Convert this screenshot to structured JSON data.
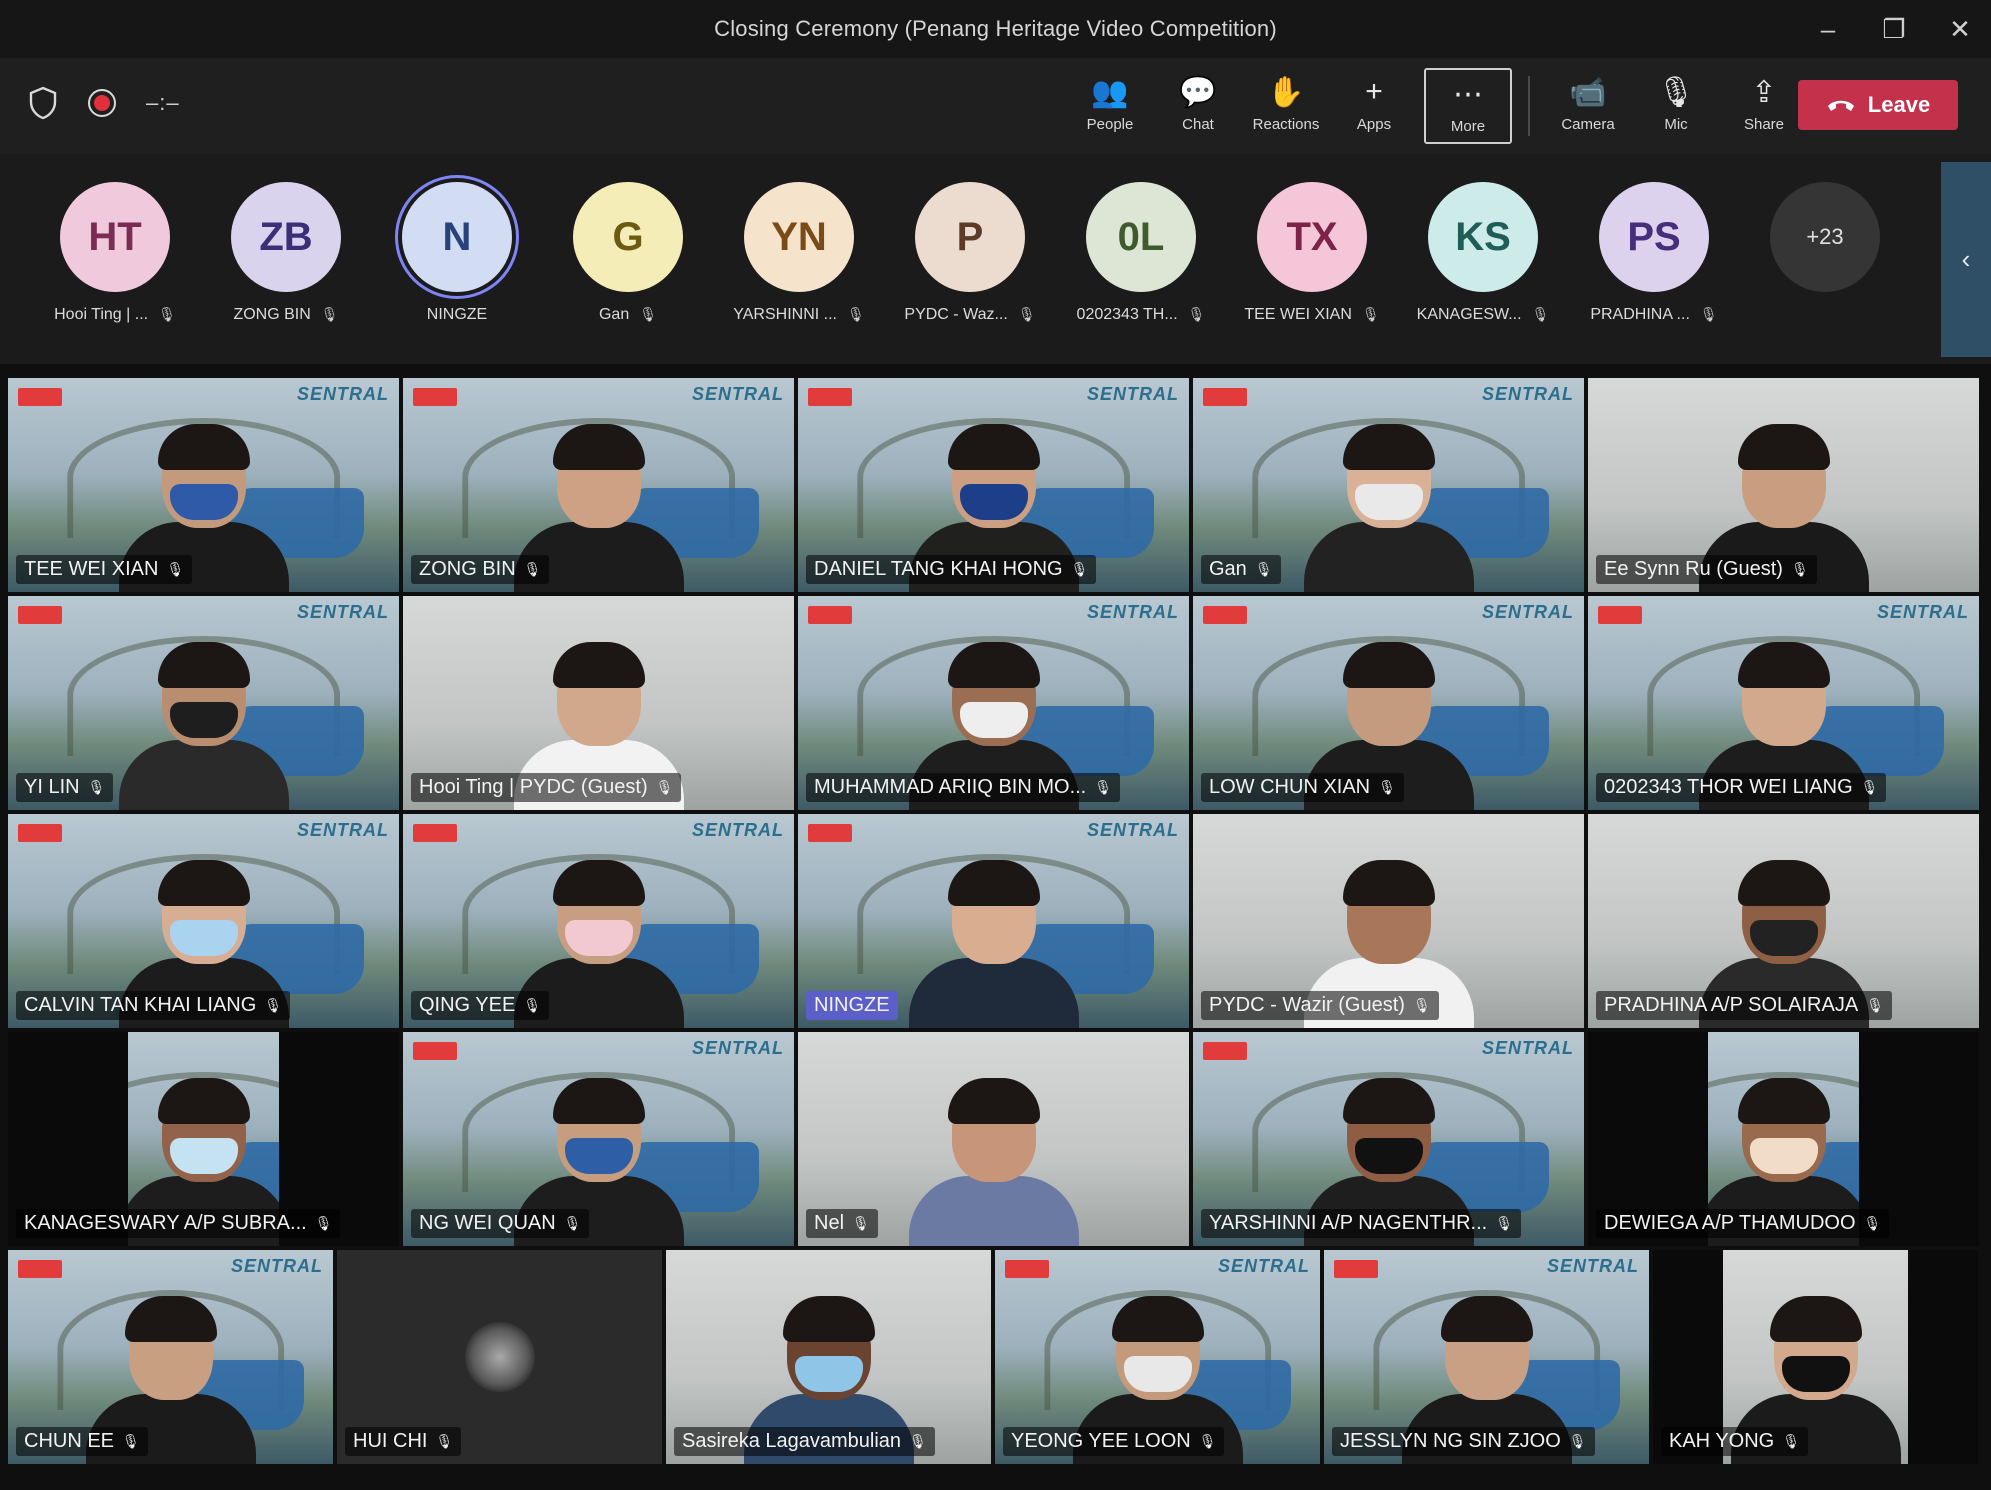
{
  "window": {
    "title": "Closing Ceremony (Penang Heritage Video Competition)",
    "controls": [
      "–",
      "❐",
      "✕"
    ]
  },
  "toolbar": {
    "timer": "–:–",
    "tools": [
      {
        "label": "People",
        "icon": "people-icon",
        "glyph": "👥"
      },
      {
        "label": "Chat",
        "icon": "chat-icon",
        "glyph": "💬"
      },
      {
        "label": "Reactions",
        "icon": "reactions-icon",
        "glyph": "✋"
      },
      {
        "label": "Apps",
        "icon": "apps-icon",
        "glyph": "+"
      },
      {
        "label": "More",
        "icon": "more-icon",
        "glyph": "⋯"
      }
    ],
    "media": [
      {
        "label": "Camera",
        "icon": "camera-icon",
        "glyph": "📹"
      },
      {
        "label": "Mic",
        "icon": "mic-off-icon",
        "glyph": "🎙"
      },
      {
        "label": "Share",
        "icon": "share-icon",
        "glyph": "⇪"
      }
    ],
    "leave_label": "Leave",
    "leave_color": "#c4314b"
  },
  "participants_strip": {
    "people": [
      {
        "initials": "HT",
        "name": "Hooi Ting | ...",
        "bg": "#f0c9dc",
        "fg": "#7a2c53"
      },
      {
        "initials": "ZB",
        "name": "ZONG BIN",
        "bg": "#d9d3ee",
        "fg": "#3c2f78"
      },
      {
        "initials": "N",
        "name": "NINGZE",
        "bg": "#d2dcf2",
        "fg": "#27437a"
      },
      {
        "initials": "G",
        "name": "Gan",
        "bg": "#f4edb8",
        "fg": "#6b5a12"
      },
      {
        "initials": "YN",
        "name": "YARSHINNI ...",
        "bg": "#f6e3cc",
        "fg": "#7a4b18"
      },
      {
        "initials": "P",
        "name": "PYDC - Waz...",
        "bg": "#ecdcd0",
        "fg": "#5b3b28"
      },
      {
        "initials": "0L",
        "name": "0202343 TH...",
        "bg": "#dde6d4",
        "fg": "#3f5a2b"
      },
      {
        "initials": "TX",
        "name": "TEE WEI XIAN",
        "bg": "#f4c6d7",
        "fg": "#7d2347"
      },
      {
        "initials": "KS",
        "name": "KANAGESW...",
        "bg": "#cdebe8",
        "fg": "#1f5e58"
      },
      {
        "initials": "PS",
        "name": "PRADHINA ...",
        "bg": "#dcd2ee",
        "fg": "#44307a"
      }
    ],
    "overflow": "+23"
  },
  "grid": {
    "rows": [
      [
        {
          "name": "TEE WEI XIAN",
          "bg": "sentral",
          "skin": "#c49a7c",
          "mask": "#2f5aa8",
          "shirt": "#1b1b1b"
        },
        {
          "name": "ZONG BIN",
          "bg": "sentral",
          "skin": "#cfa184",
          "mask": "",
          "shirt": "#1c1c1c"
        },
        {
          "name": "DANIEL TANG KHAI HONG",
          "bg": "sentral",
          "skin": "#cc9f83",
          "mask": "#1d3f8a",
          "shirt": "#20201f"
        },
        {
          "name": "Gan",
          "bg": "sentral",
          "skin": "#d8b196",
          "mask": "#e9e9ea",
          "shirt": "#222"
        },
        {
          "name": "Ee Synn Ru (Guest)",
          "bg": "room",
          "skin": "#c99d80",
          "mask": "",
          "shirt": "#1a1a1a"
        }
      ],
      [
        {
          "name": "YI LIN",
          "bg": "sentral",
          "skin": "#b98e70",
          "mask": "#1e1e1e",
          "shirt": "#2a2a2a"
        },
        {
          "name": "Hooi Ting | PYDC (Guest)",
          "bg": "room",
          "skin": "#d1a88c",
          "mask": "",
          "shirt": "#f2f2f2"
        },
        {
          "name": "MUHAMMAD ARIIQ BIN MO...",
          "bg": "sentral",
          "skin": "#9b6d52",
          "mask": "#eeeeee",
          "shirt": "#1e1e1e"
        },
        {
          "name": "LOW CHUN XIAN",
          "bg": "sentral",
          "skin": "#c49b7e",
          "mask": "",
          "shirt": "#1d1d1d"
        },
        {
          "name": "0202343 THOR WEI LIANG",
          "bg": "sentral",
          "skin": "#d2a98d",
          "mask": "",
          "shirt": "#1d1d1d"
        }
      ],
      [
        {
          "name": "CALVIN TAN KHAI LIANG",
          "bg": "sentral",
          "skin": "#d7ae93",
          "mask": "#a9d3ee",
          "shirt": "#1c1c1c"
        },
        {
          "name": "QING YEE",
          "bg": "sentral",
          "skin": "#c89e82",
          "mask": "#f2c8d1",
          "shirt": "#1c1c1c"
        },
        {
          "name": "NINGZE",
          "bg": "sentral",
          "skin": "#d9ad8f",
          "mask": "",
          "shirt": "#1f2a3a"
        },
        {
          "name": "PYDC - Wazir (Guest)",
          "bg": "room",
          "skin": "#a8775a",
          "mask": "",
          "shirt": "#f1f1f1"
        },
        {
          "name": "PRADHINA A/P SOLAIRAJA",
          "bg": "room",
          "skin": "#8e5f45",
          "mask": "#222",
          "shirt": "#2a2a2a"
        }
      ],
      [
        {
          "name": "KANAGESWARY A/P SUBRA...",
          "bg": "sentral",
          "skin": "#92634a",
          "mask": "#c5e2f2",
          "shirt": "#1d1d1d"
        },
        {
          "name": "NG WEI QUAN",
          "bg": "sentral",
          "skin": "#c79d80",
          "mask": "#2e5fa6",
          "shirt": "#1d1d1d"
        },
        {
          "name": "Nel",
          "bg": "room",
          "skin": "#c6957a",
          "mask": "",
          "shirt": "#6a7aa2"
        },
        {
          "name": "YARSHINNI A/P NAGENTHR...",
          "bg": "sentral",
          "skin": "#8e5d44",
          "mask": "#111",
          "shirt": "#1e1e1e"
        },
        {
          "name": "DEWIEGA A/P THAMUDOO",
          "bg": "sentral",
          "skin": "#9a6a4f",
          "mask": "#f1dcc8",
          "shirt": "#1c1c1c"
        }
      ],
      [
        {
          "name": "CHUN EE",
          "bg": "sentral",
          "skin": "#c99f82",
          "mask": "",
          "shirt": "#1b1b1b"
        },
        {
          "name": "HUI CHI",
          "bg": "grey",
          "skin": "",
          "mask": "",
          "shirt": ""
        },
        {
          "name": "Sasireka Lagavambulian",
          "bg": "room",
          "skin": "#6a4331",
          "mask": "#8fc6e8",
          "shirt": "#2f4a6a"
        },
        {
          "name": "YEONG YEE LOON",
          "bg": "sentral",
          "skin": "#c49a7d",
          "mask": "#e8e8e8",
          "shirt": "#1b1b1b"
        },
        {
          "name": "JESSLYN NG SIN ZJOO",
          "bg": "sentral",
          "skin": "#caa085",
          "mask": "",
          "shirt": "#1b1b1b"
        },
        {
          "name": "KAH YONG",
          "bg": "room",
          "skin": "#d2a98d",
          "mask": "#111",
          "shirt": "#1b1b1b"
        }
      ]
    ],
    "brand_label": "SENTRAL"
  }
}
